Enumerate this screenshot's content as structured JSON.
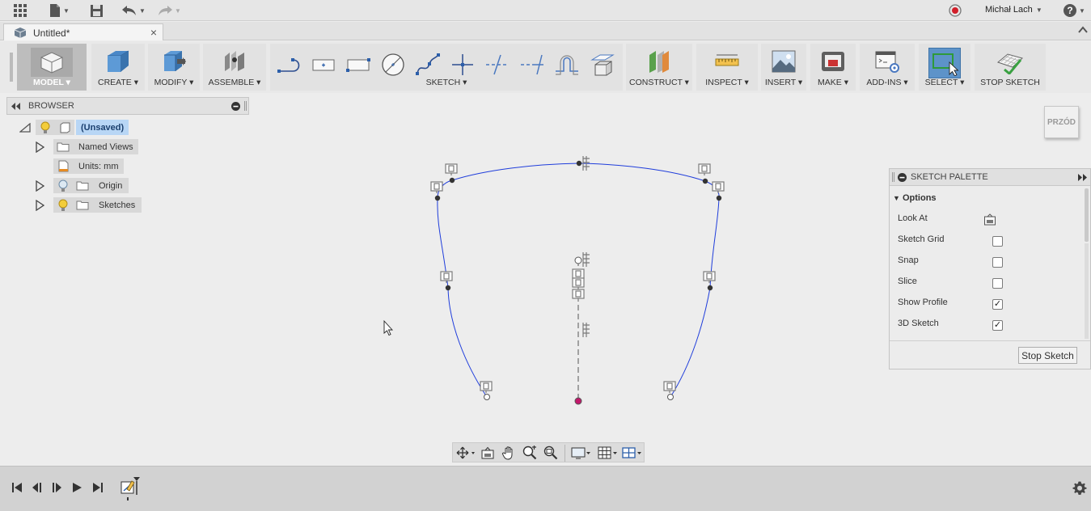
{
  "topbar": {
    "user_name": "Michał Lach"
  },
  "tab": {
    "title": "Untitled*",
    "close": "×"
  },
  "ribbon": {
    "groups": [
      {
        "label": "MODEL ▾"
      },
      {
        "label": "CREATE ▾"
      },
      {
        "label": "MODIFY ▾"
      },
      {
        "label": "ASSEMBLE ▾"
      },
      {
        "label": "SKETCH ▾"
      },
      {
        "label": "CONSTRUCT ▾"
      },
      {
        "label": "INSPECT ▾"
      },
      {
        "label": "INSERT ▾"
      },
      {
        "label": "MAKE ▾"
      },
      {
        "label": "ADD-INS ▾"
      },
      {
        "label": "SELECT ▾"
      },
      {
        "label": "STOP SKETCH"
      }
    ]
  },
  "browser": {
    "title": "BROWSER",
    "root": "(Unsaved)",
    "items": [
      "Named Views",
      "Units: mm",
      "Origin",
      "Sketches"
    ]
  },
  "viewcube": {
    "face": "PRZÓD"
  },
  "palette": {
    "title": "SKETCH PALETTE",
    "section": "Options",
    "options": [
      {
        "label": "Look At",
        "type": "button"
      },
      {
        "label": "Sketch Grid",
        "checked": false
      },
      {
        "label": "Snap",
        "checked": false
      },
      {
        "label": "Slice",
        "checked": false
      },
      {
        "label": "Show Profile",
        "checked": true
      },
      {
        "label": "3D Sketch",
        "checked": true
      }
    ],
    "stop_button": "Stop Sketch"
  },
  "colors": {
    "accent": "#4d8fce",
    "sketch_line": "#1f3ddb",
    "select_active": "#5d93c9",
    "selection_blue": "#b8d6f5"
  }
}
